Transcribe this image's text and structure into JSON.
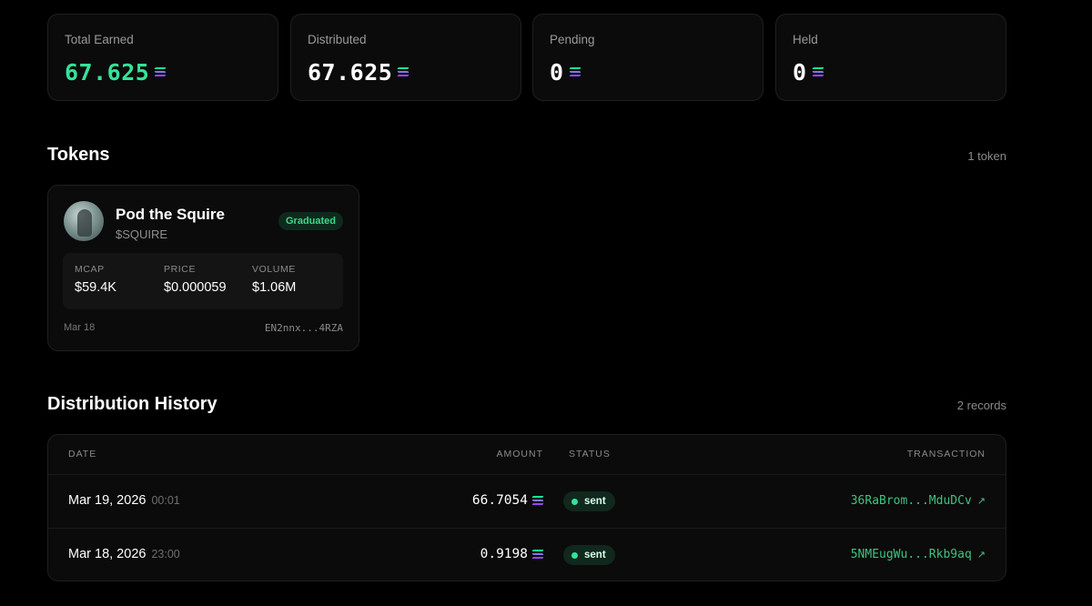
{
  "stats": [
    {
      "label": "Total Earned",
      "value": "67.625",
      "accent": "#33e398"
    },
    {
      "label": "Distributed",
      "value": "67.625"
    },
    {
      "label": "Pending",
      "value": "0"
    },
    {
      "label": "Held",
      "value": "0"
    }
  ],
  "currency_icon": "solana-icon",
  "tokens": {
    "title": "Tokens",
    "count": "1 token",
    "card": {
      "name": "Pod the Squire",
      "symbol": "$SQUIRE",
      "badge": "Graduated",
      "mcap_label": "MCAP",
      "mcap": "$59.4K",
      "price_label": "PRICE",
      "price": "$0.000059",
      "volume_label": "VOLUME",
      "volume": "$1.06M",
      "date": "Mar 18",
      "address": "EN2nnx...4RZA"
    }
  },
  "history": {
    "title": "Distribution History",
    "count": "2 records",
    "columns": {
      "date": "DATE",
      "amount": "AMOUNT",
      "status": "STATUS",
      "transaction": "TRANSACTION"
    },
    "rows": [
      {
        "date": "Mar 19, 2026",
        "time": "00:01",
        "amount": "66.7054",
        "status": "sent",
        "tx": "36RaBrom...MduDCv"
      },
      {
        "date": "Mar 18, 2026",
        "time": "23:00",
        "amount": "0.9198",
        "status": "sent",
        "tx": "5NMEugWu...Rkb9aq"
      }
    ]
  },
  "colors": {
    "accent_green": "#33e398",
    "background": "#000000",
    "card": "#0b0b0b"
  }
}
